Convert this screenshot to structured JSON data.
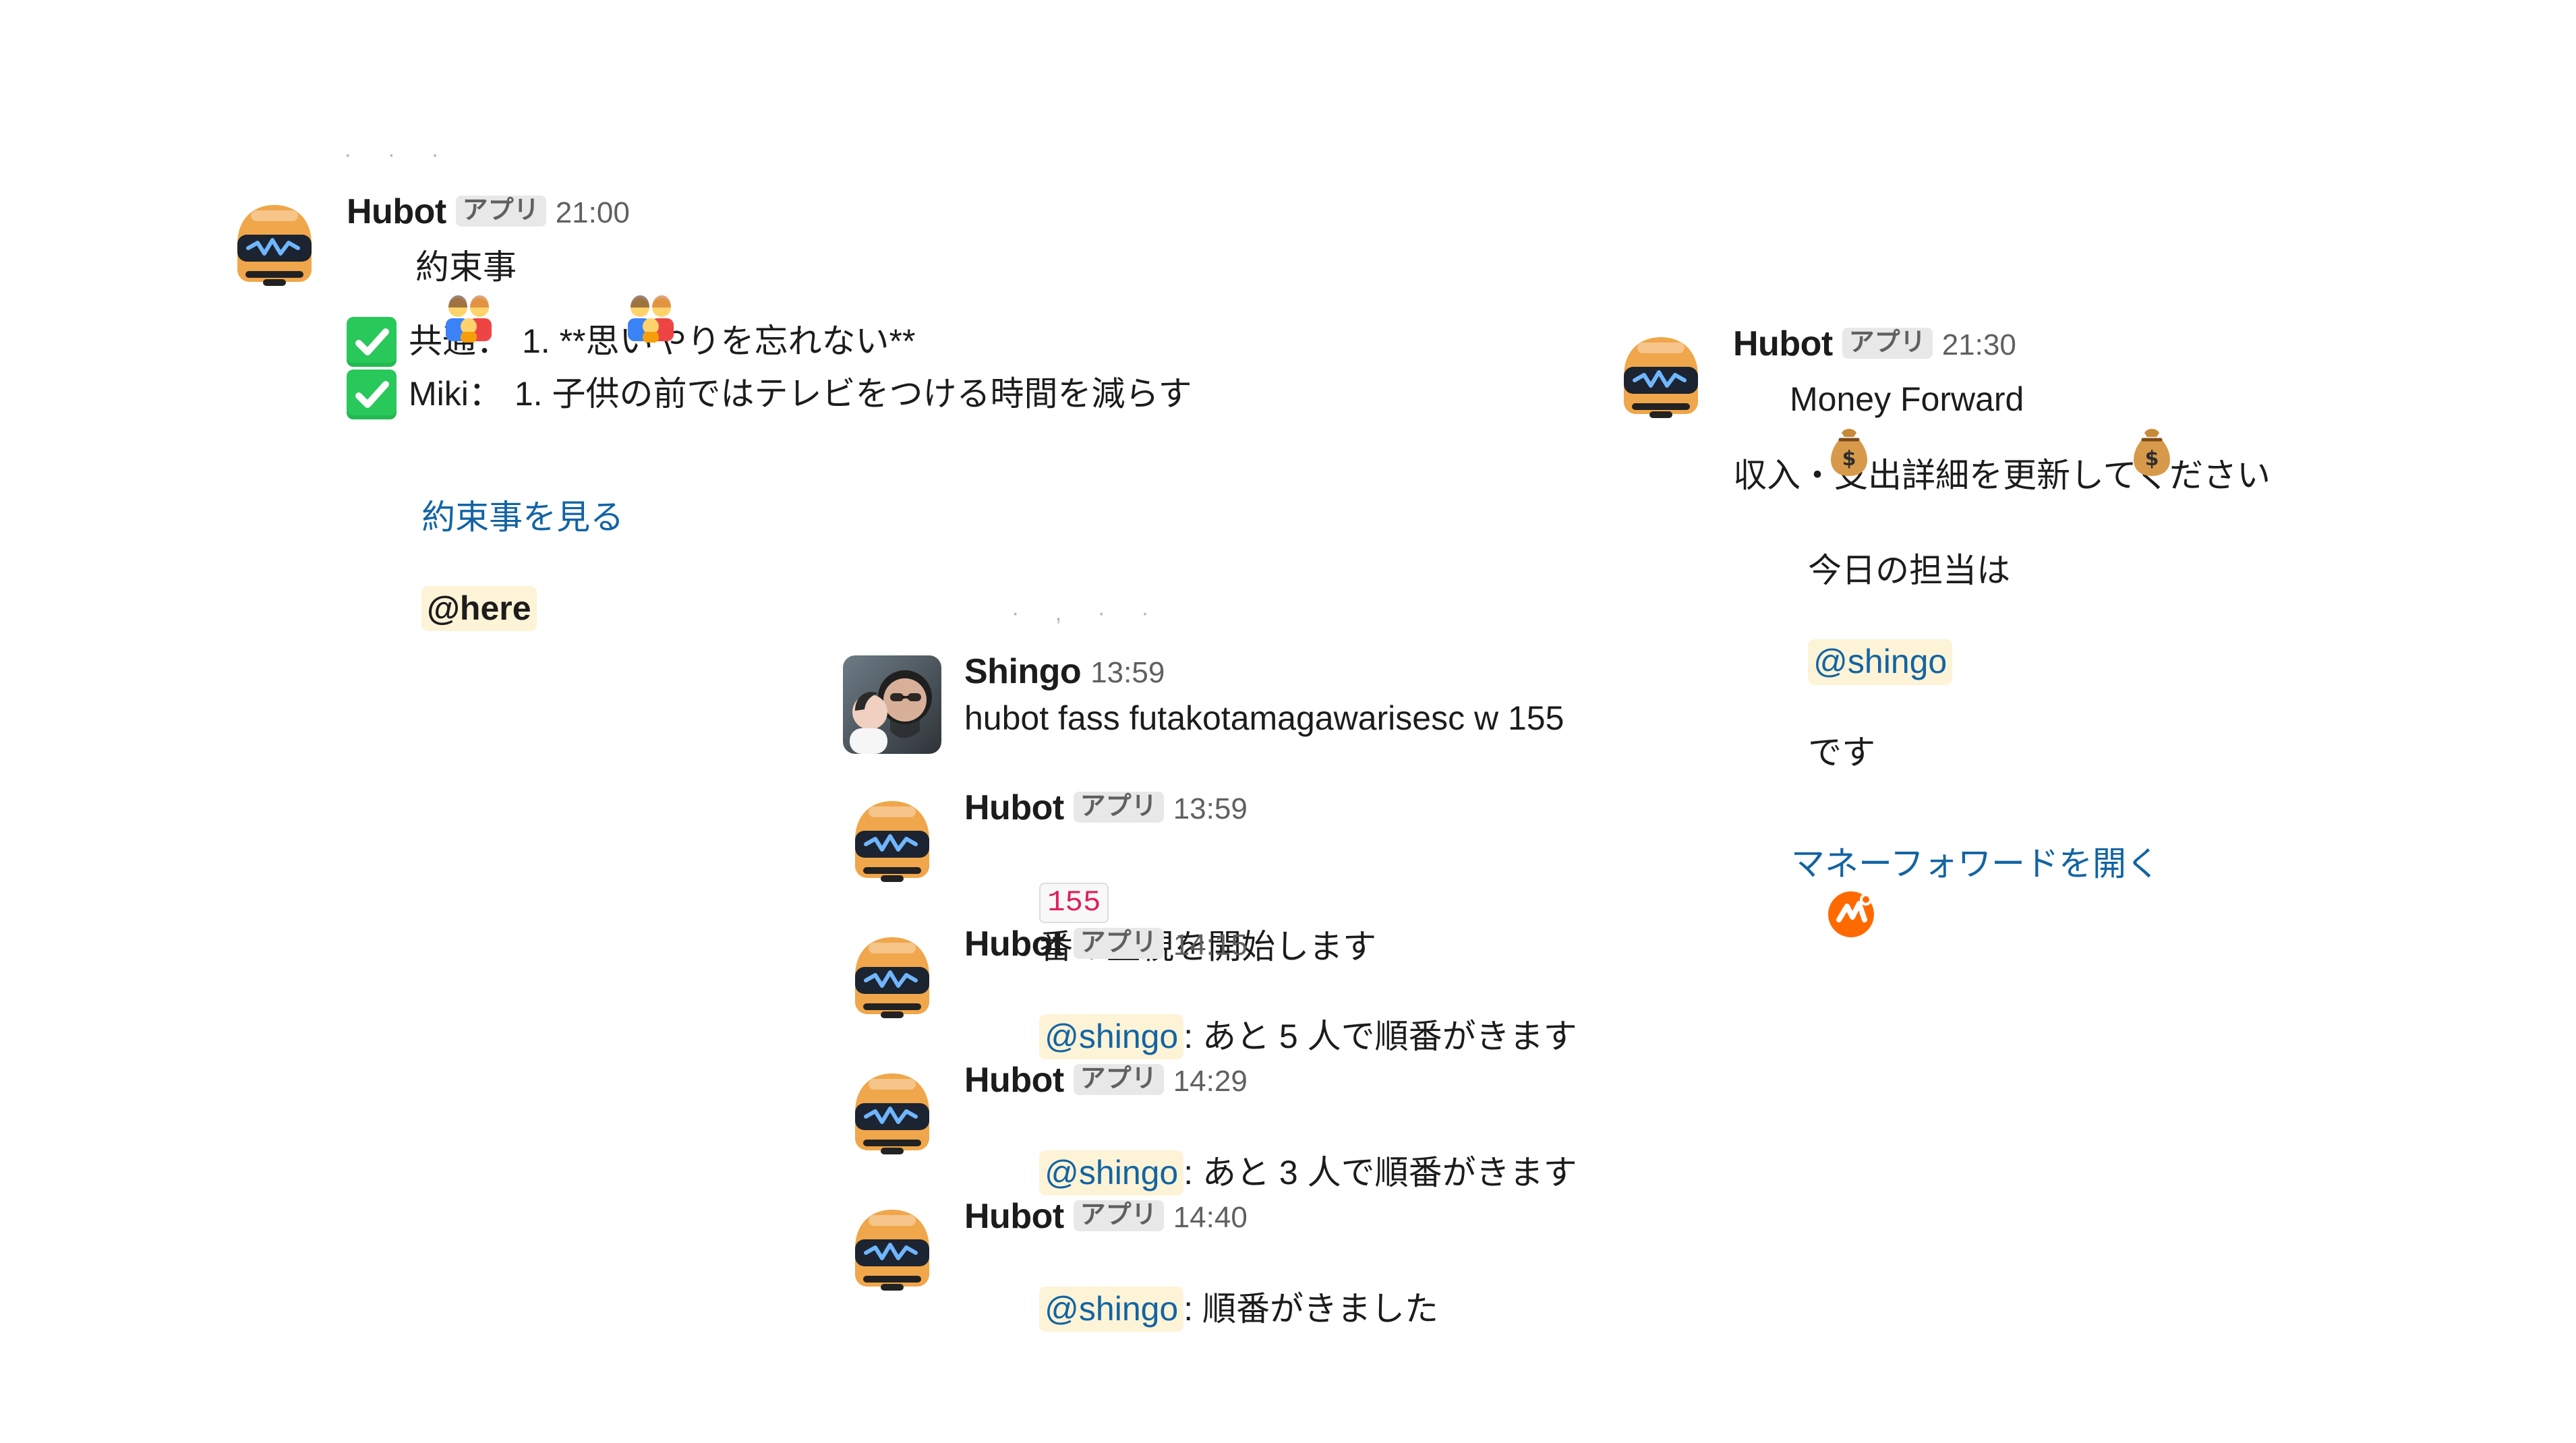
{
  "colors": {
    "link": "#1264a3",
    "muted": "#616061",
    "mention_bg": "#fdf3d6",
    "badge_bg": "#e8e8e8",
    "code_text": "#e01e5a",
    "robot": "#f0a64a"
  },
  "icons": {
    "hubot_avatar": "hubot-robot-avatar",
    "shingo_avatar": "shingo-photo-avatar",
    "family": "family-emoji-icon",
    "check": "check-mark-icon",
    "money_bag": "money-bag-icon",
    "money_forward": "money-forward-logo-icon"
  },
  "messages": {
    "hubot_21_00": {
      "name": "Hubot",
      "badge": "アプリ",
      "time": "21:00",
      "title": "約束事",
      "lines": [
        {
          "label": "共通：",
          "text": "1. **思いやりを忘れない**"
        },
        {
          "label": "Miki：",
          "text": "1. 子供の前ではテレビをつける時間を減らす"
        }
      ],
      "link_text": "約束事を見る",
      "here_text": "@here"
    },
    "hubot_21_30": {
      "name": "Hubot",
      "badge": "アプリ",
      "time": "21:30",
      "title": "Money Forward",
      "line1": "収入・支出詳細を更新してください",
      "line2_prefix": "今日の担当は",
      "line2_mention": "@shingo",
      "line2_suffix": "です",
      "link_text": "マネーフォワードを開く"
    },
    "shingo_13_59": {
      "name": "Shingo",
      "time": "13:59",
      "text": "hubot fass futakotamagawarisesc w 155"
    },
    "hubot_13_59": {
      "name": "Hubot",
      "badge": "アプリ",
      "time": "13:59",
      "code": "155",
      "text_after_code": "番の監視を開始します"
    },
    "hubot_14_15": {
      "name": "Hubot",
      "badge": "アプリ",
      "time": "14:15",
      "mention": "@shingo",
      "text": ": あと 5 人で順番がきます"
    },
    "hubot_14_29": {
      "name": "Hubot",
      "badge": "アプリ",
      "time": "14:29",
      "mention": "@shingo",
      "text": ": あと 3 人で順番がきます"
    },
    "hubot_14_40": {
      "name": "Hubot",
      "badge": "アプリ",
      "time": "14:40",
      "mention": "@shingo",
      "text": ": 順番がきました"
    }
  }
}
